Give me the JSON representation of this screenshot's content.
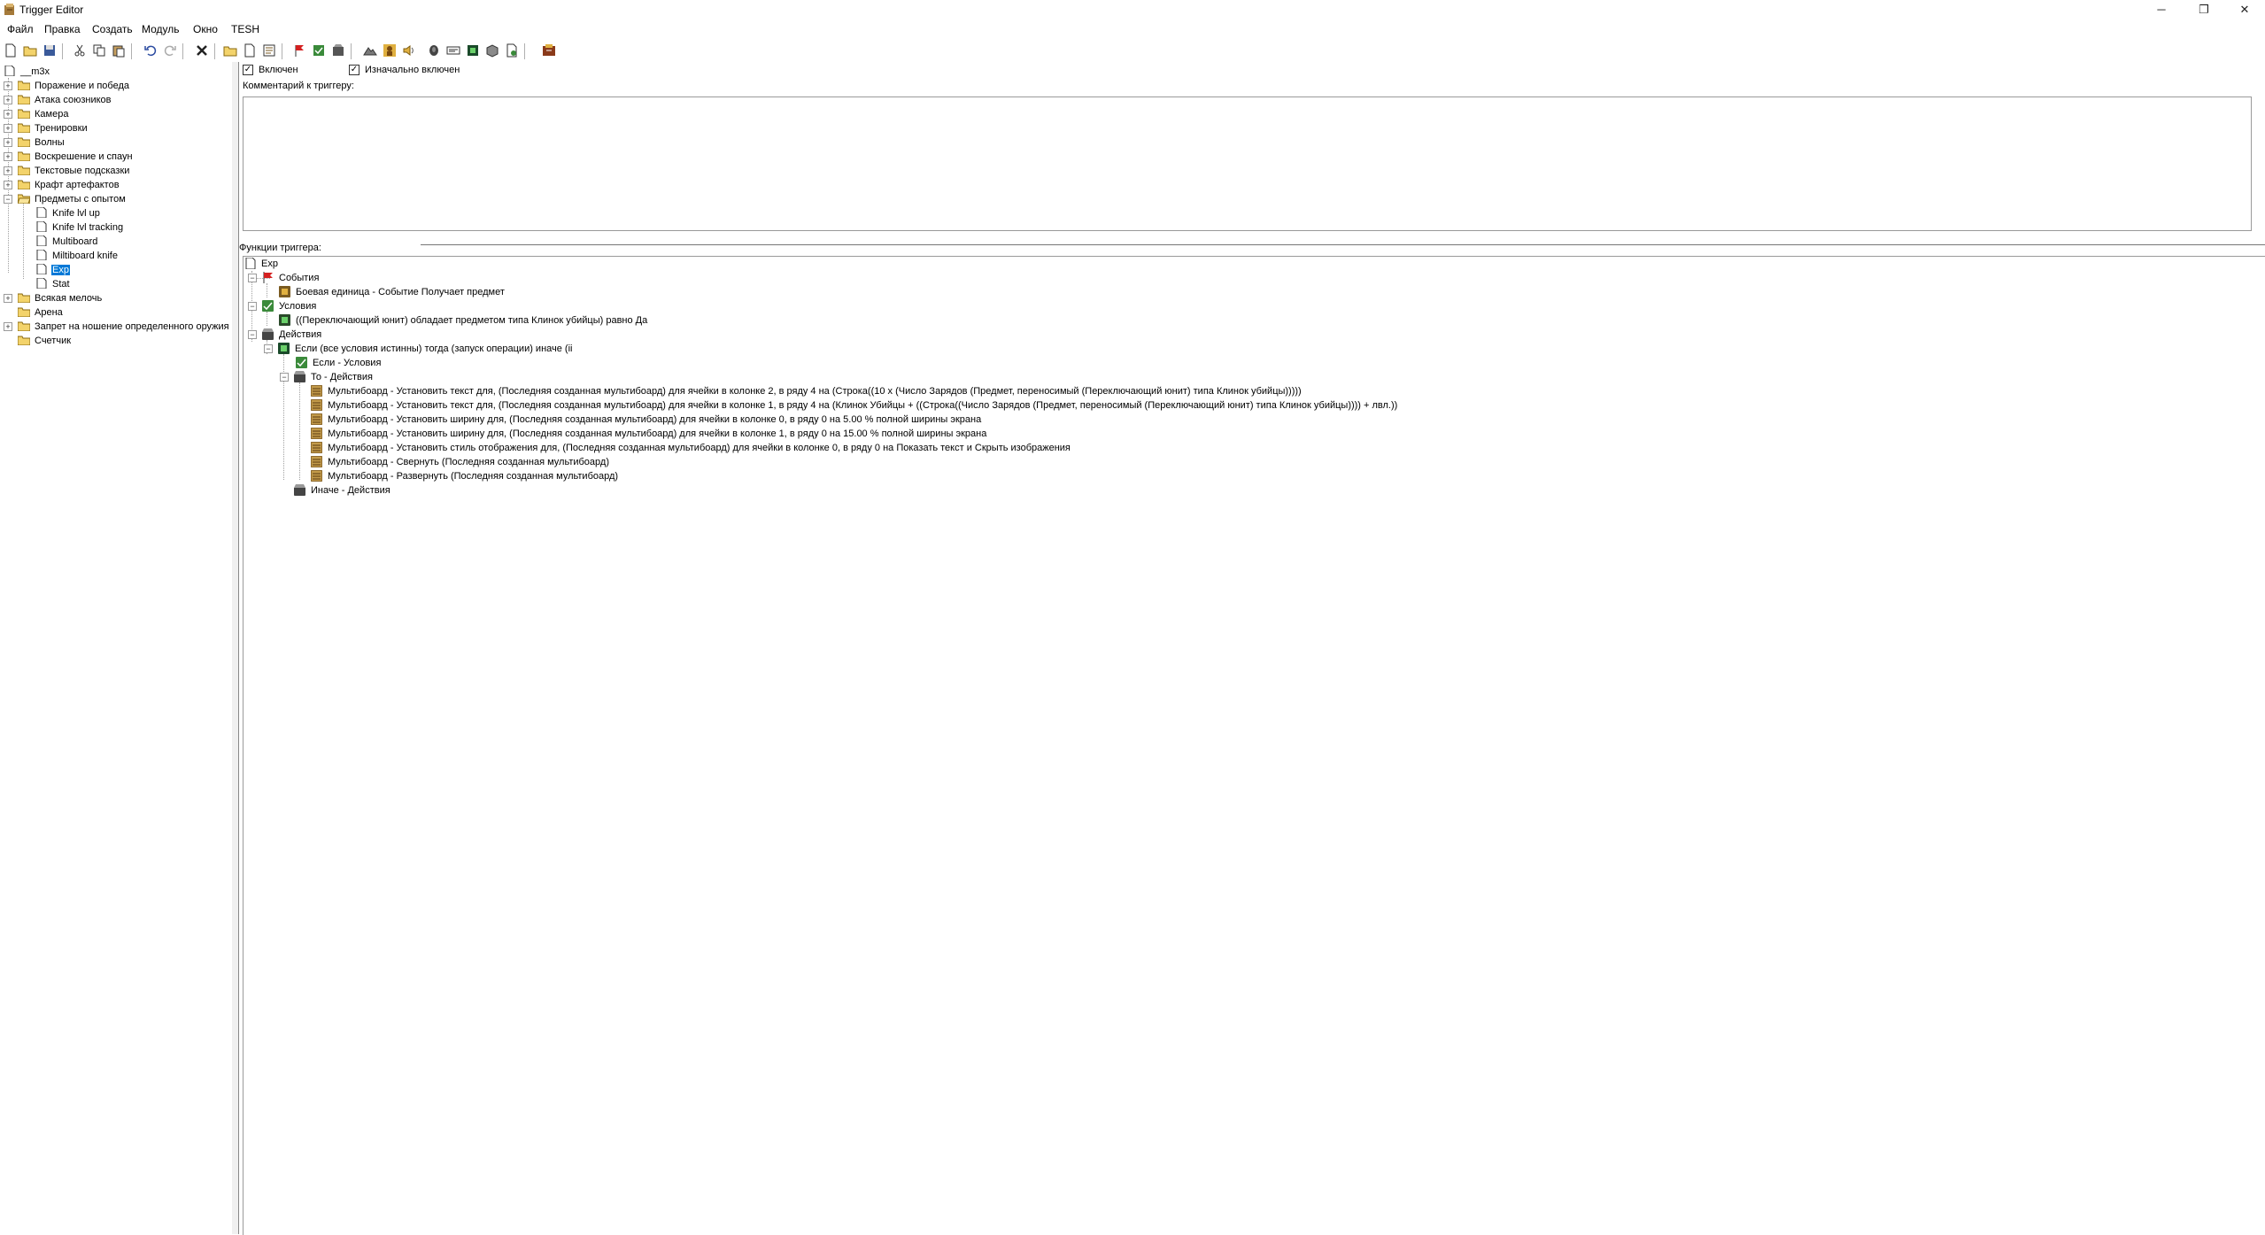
{
  "window": {
    "title": "Trigger Editor",
    "minimize": "─",
    "restore": "❐",
    "close": "✕"
  },
  "menu": [
    "Файл",
    "Правка",
    "Создать",
    "Модуль",
    "Окно",
    "TESH"
  ],
  "trigger_tree": {
    "root": "__m3x",
    "folders": [
      {
        "label": "Поражение и победа"
      },
      {
        "label": "Атака союзников"
      },
      {
        "label": "Камера"
      },
      {
        "label": "Тренировки"
      },
      {
        "label": "Волны"
      },
      {
        "label": "Воскрешение и спаун"
      },
      {
        "label": "Текстовые подсказки"
      },
      {
        "label": "Крафт артефактов"
      },
      {
        "label": "Предметы с опытом"
      },
      {
        "label": "Всякая мелочь"
      },
      {
        "label": "Арена"
      },
      {
        "label": "Запрет на ношение определенного оружия"
      },
      {
        "label": "Счетчик"
      }
    ],
    "open_folder_triggers": [
      "Knife lvl up",
      "Knife lvl tracking",
      "Multiboard",
      "Miltiboard knife",
      "Exp",
      "Stat"
    ],
    "selected": "Exp"
  },
  "trigger_panel": {
    "enabled_label": "Включен",
    "initially_on_label": "Изначально включен",
    "enabled": true,
    "initially_on": true,
    "comment_label": "Комментарий к триггеру:",
    "comment": "",
    "functions_label": "Функции триггера:"
  },
  "functions": {
    "name": "Exp",
    "events_label": "События",
    "event1": "Боевая единица - Событие Получает предмет",
    "conditions_label": "Условия",
    "condition1": "((Переключающий юнит) обладает предметом типа Клинок убийцы) равно Да",
    "actions_label": "Действия",
    "if_block": "Если (все условия истинны) тогда (запуск операции) иначе (ii",
    "if_conditions": "Если - Условия",
    "then_actions": "То - Действия",
    "action_lines": [
      "Мультибоард - Установить текст для,  (Последняя созданная мультибоард) для ячейки в колонке 2, в ряду 4 на (Строка((10 x (Число Зарядов (Предмет, переносимый (Переключающий юнит) типа Клинок убийцы)))))",
      "Мультибоард - Установить текст для,  (Последняя созданная мультибоард) для ячейки в колонке 1, в ряду 4 на (Клинок Убийцы  + ((Строка((Число Зарядов (Предмет, переносимый (Переключающий юнит) типа Клинок убийцы)))) +  лвл.))",
      "Мультибоард - Установить ширину для,  (Последняя созданная мультибоард) для ячейки в колонке 0, в ряду 0 на 5.00 % полной ширины экрана",
      "Мультибоард - Установить ширину для,  (Последняя созданная мультибоард) для ячейки в колонке 1, в ряду 0 на 15.00 % полной ширины экрана",
      "Мультибоард - Установить стиль отображения для,  (Последняя созданная мультибоард) для ячейки в колонке 0, в ряду 0 на Показать текст и Скрыть изображения",
      "Мультибоард - Свернуть (Последняя созданная мультибоард)",
      "Мультибоард - Развернуть (Последняя созданная мультибоард)"
    ],
    "else_actions": "Иначе - Действия"
  },
  "colors": {
    "selection": "#0078d7",
    "folder": "#f3d36b",
    "event_flag": "#d42020",
    "action_icon": "#c29a4a"
  }
}
